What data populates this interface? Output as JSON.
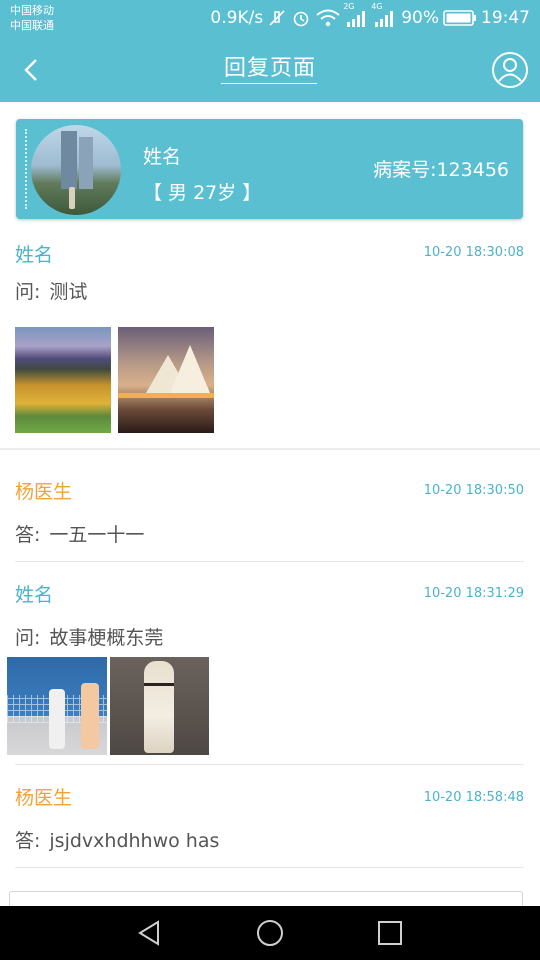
{
  "status_bar": {
    "carrier_1": "中国移动",
    "carrier_2": "中国联通",
    "speed": "0.9K/s",
    "net_2g": "2G",
    "net_4g": "4G",
    "battery": "90%",
    "time": "19:47"
  },
  "header": {
    "title": "回复页面",
    "back_icon": "chevron-left-icon",
    "user_icon": "user-circle-icon"
  },
  "patient": {
    "name": "姓名",
    "gender_age": "【 男 27岁 】",
    "case_number": "病案号:123456"
  },
  "messages": [
    {
      "type": "question",
      "name": "姓名",
      "time": "10-20 18:30:08",
      "prefix": "问:",
      "text": "测试",
      "images": [
        "mountain-autumn-photo",
        "sydney-opera-house-photo"
      ]
    },
    {
      "type": "answer",
      "name": "杨医生",
      "time": "10-20 18:30:50",
      "prefix": "答:",
      "text": "一五一十一",
      "images": []
    },
    {
      "type": "question",
      "name": "姓名",
      "time": "10-20 18:31:29",
      "prefix": "问:",
      "text": "故事梗概东莞",
      "images": [
        "tennis-players-photo",
        "fashion-model-photo"
      ]
    },
    {
      "type": "answer",
      "name": "杨医生",
      "time": "10-20 18:58:48",
      "prefix": "答:",
      "text": "jsjdvxhdhhwo has",
      "images": []
    }
  ],
  "colors": {
    "primary": "#5bbfd2",
    "question_name": "#4bb3cc",
    "answer_name": "#f0a338",
    "body_text": "#555555"
  }
}
